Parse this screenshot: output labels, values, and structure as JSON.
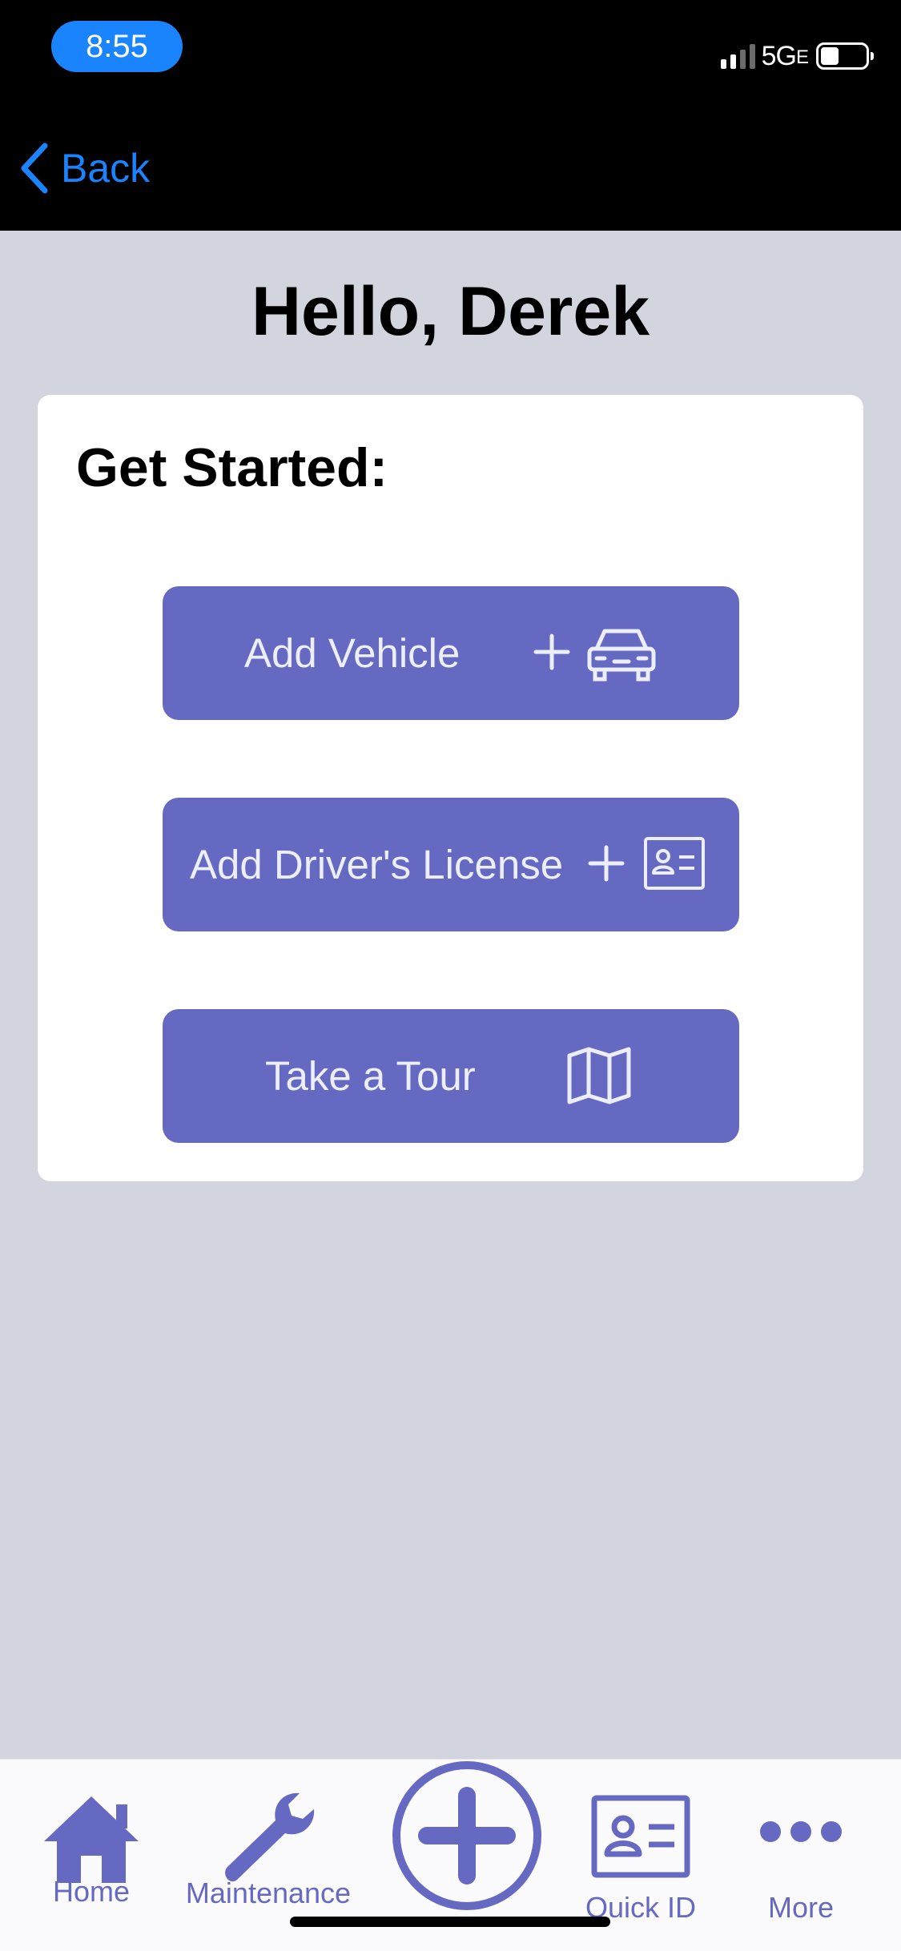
{
  "status_bar": {
    "time": "8:55",
    "network": "5G",
    "network_suffix": "E"
  },
  "nav": {
    "back_label": "Back"
  },
  "greeting": "Hello, Derek",
  "card": {
    "title": "Get Started:",
    "buttons": [
      {
        "label": "Add Vehicle",
        "icons": [
          "plus-icon",
          "car-icon"
        ]
      },
      {
        "label": "Add Driver's License",
        "icons": [
          "plus-icon",
          "id-card-icon"
        ]
      },
      {
        "label": "Take a Tour",
        "icons": [
          "map-icon"
        ]
      }
    ]
  },
  "tabbar": {
    "items": [
      {
        "label": "Home",
        "icon": "home-icon"
      },
      {
        "label": "Maintenance",
        "icon": "wrench-icon"
      },
      {
        "label": "",
        "icon": "add-circle-icon"
      },
      {
        "label": "Quick ID",
        "icon": "id-card-icon"
      },
      {
        "label": "More",
        "icon": "more-dots-icon"
      }
    ]
  },
  "colors": {
    "accent": "#6669c2",
    "ios_blue": "#1a84ff",
    "background": "#d2d5de",
    "header": "#000000"
  }
}
